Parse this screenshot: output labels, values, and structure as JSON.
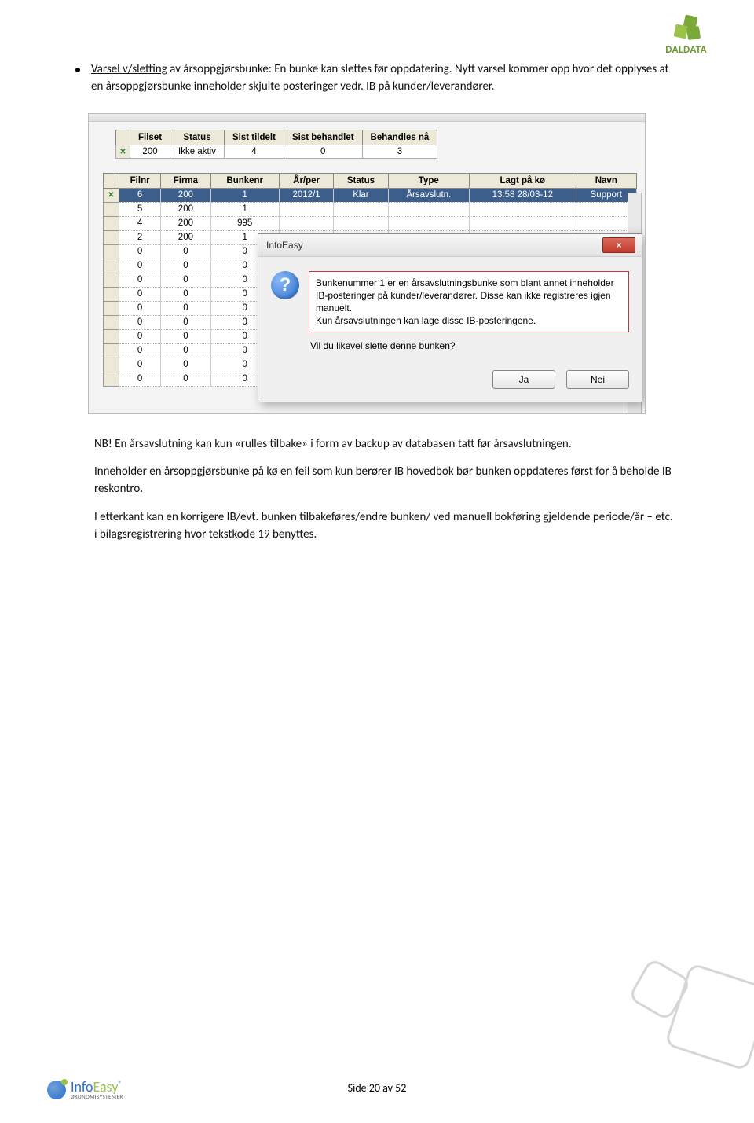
{
  "brand_top": "DALDATA",
  "bullet": {
    "lead": "Varsel v/sletting",
    "lead_rest": " av årsoppgjørsbunke:  En bunke kan slettes før oppdatering. Nytt varsel kommer opp hvor det opplyses at en årsoppgjørsbunke inneholder skjulte posteringer vedr. IB på kunder/leverandører."
  },
  "screenshot": {
    "table1": {
      "headers": [
        "",
        "Filset",
        "Status",
        "Sist tildelt",
        "Sist behandlet",
        "Behandles nå"
      ],
      "row": [
        "",
        "200",
        "Ikke aktiv",
        "4",
        "0",
        "3"
      ]
    },
    "table2": {
      "headers": [
        "",
        "Filnr",
        "Firma",
        "Bunkenr",
        "År/per",
        "Status",
        "Type",
        "Lagt på kø",
        "Navn"
      ],
      "rows": [
        [
          "",
          "6",
          "200",
          "1",
          "2012/1",
          "Klar",
          "Årsavslutn.",
          "13:58 28/03-12",
          "Support"
        ],
        [
          "",
          "5",
          "200",
          "1",
          "",
          "",
          "",
          "",
          ""
        ],
        [
          "",
          "4",
          "200",
          "995",
          "",
          "",
          "",
          "",
          ""
        ],
        [
          "",
          "2",
          "200",
          "1",
          "",
          "",
          "",
          "",
          ""
        ],
        [
          "",
          "0",
          "0",
          "0",
          "",
          "",
          "",
          "",
          ""
        ],
        [
          "",
          "0",
          "0",
          "0",
          "",
          "",
          "",
          "",
          ""
        ],
        [
          "",
          "0",
          "0",
          "0",
          "",
          "",
          "",
          "",
          ""
        ],
        [
          "",
          "0",
          "0",
          "0",
          "",
          "",
          "",
          "",
          ""
        ],
        [
          "",
          "0",
          "0",
          "0",
          "",
          "",
          "",
          "",
          ""
        ],
        [
          "",
          "0",
          "0",
          "0",
          "",
          "",
          "",
          "",
          ""
        ],
        [
          "",
          "0",
          "0",
          "0",
          "",
          "",
          "",
          "",
          ""
        ],
        [
          "",
          "0",
          "0",
          "0",
          "",
          "",
          "",
          "",
          ""
        ],
        [
          "",
          "0",
          "0",
          "0",
          "",
          "",
          "",
          "",
          ""
        ],
        [
          "",
          "0",
          "0",
          "0",
          "",
          "",
          "",
          "",
          ""
        ]
      ]
    },
    "dialog": {
      "title": "InfoEasy",
      "close_glyph": "×",
      "question_glyph": "?",
      "message_main": "Bunkenummer 1 er en årsavslutningsbunke som blant annet inneholder IB-posteringer på kunder/leverandører. Disse kan ikke registreres igjen manuelt.\nKun årsavslutningen kan lage disse IB-posteringene.",
      "message_confirm": "Vil du likevel slette denne bunken?",
      "btn_yes": "Ja",
      "btn_no": "Nei"
    }
  },
  "after": {
    "nb": "NB! En årsavslutning kan kun «rulles tilbake» i form av backup av databasen tatt før årsavslutningen.",
    "p2": "Inneholder en årsoppgjørsbunke på kø en feil som kun berører IB hovedbok bør bunken oppdateres først for å beholde IB reskontro.",
    "p3": "I etterkant kan en korrigere IB/evt. bunken tilbakeføres/endre bunken/ ved manuell bokføring gjeldende periode/år – etc. i bilagsregistrering hvor tekstkode 19 benyttes."
  },
  "footer": {
    "brand": "InfoEasy",
    "sub": "ØKONOMISYSTEMER",
    "page": "Side 20 av 52"
  }
}
